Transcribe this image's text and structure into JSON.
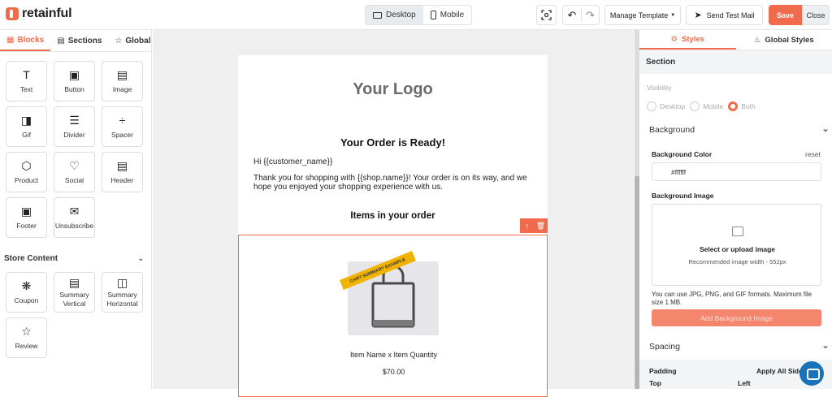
{
  "app": {
    "brand": "retainful"
  },
  "toolbar": {
    "device_desktop": "Desktop",
    "device_mobile": "Mobile",
    "manage_template": "Manage Template",
    "send_test_mail": "Send Test Mail",
    "save": "Save",
    "close": "Close"
  },
  "left_panel": {
    "tabs": [
      {
        "label": "Blocks",
        "active": true
      },
      {
        "label": "Sections",
        "active": false
      },
      {
        "label": "Global",
        "active": false
      }
    ],
    "blocks": [
      {
        "label": "Text",
        "icon": "text-icon"
      },
      {
        "label": "Button",
        "icon": "button-icon"
      },
      {
        "label": "Image",
        "icon": "image-icon"
      },
      {
        "label": "Gif",
        "icon": "gif-icon"
      },
      {
        "label": "Divider",
        "icon": "divider-icon"
      },
      {
        "label": "Spacer",
        "icon": "spacer-icon"
      },
      {
        "label": "Product",
        "icon": "product-icon"
      },
      {
        "label": "Social",
        "icon": "heart-icon"
      },
      {
        "label": "Header",
        "icon": "header-icon"
      },
      {
        "label": "Footer",
        "icon": "footer-icon"
      },
      {
        "label": "Unsubscribe",
        "icon": "unsubscribe-icon"
      }
    ],
    "store_content_title": "Store Content",
    "store_blocks": [
      {
        "label": "Coupon",
        "icon": "coupon-icon"
      },
      {
        "label": "Summary Vertical",
        "icon": "summary-vertical-icon"
      },
      {
        "label": "Summary Horizontal",
        "icon": "summary-horizontal-icon"
      },
      {
        "label": "Review",
        "icon": "star-icon"
      }
    ]
  },
  "email": {
    "logo": "Your Logo",
    "title": "Your Order is Ready!",
    "greeting": "Hi {{customer_name}}",
    "body": "Thank you for shopping with {{shop.name}}! Your order is on its way, and we hope you enjoyed your shopping experience with us.",
    "items_heading": "Items in your order",
    "ribbon": "CART SUMMARY EXAMPLE",
    "product_name": "Item Name x Item Quantity",
    "product_price": "$70.00"
  },
  "right_panel": {
    "tabs": [
      {
        "label": "Styles",
        "active": true
      },
      {
        "label": "Global Styles",
        "active": false
      }
    ],
    "section_title": "Section",
    "visibility_label": "Visibility",
    "visibility_options": [
      {
        "label": "Desktop",
        "selected": false
      },
      {
        "label": "Mobile",
        "selected": false
      },
      {
        "label": "Both",
        "selected": true
      }
    ],
    "background_title": "Background",
    "bg_color_label": "Background Color",
    "reset": "reset",
    "bg_color_value": "#ffffff",
    "bg_image_label": "Background Image",
    "upload_title": "Select or upload image",
    "upload_sub": "Recommended image width - 552px",
    "format_note": "You can use JPG, PNG, and GIF formats. Maximum file size 1 MB.",
    "add_bg_button": "Add Background Image",
    "spacing_title": "Spacing",
    "padding_label": "Padding",
    "apply_all_sides": "Apply All Sides",
    "top_label": "Top",
    "left_label": "Left"
  },
  "colors": {
    "accent": "#f06b4c",
    "canvas": "#efefef"
  }
}
